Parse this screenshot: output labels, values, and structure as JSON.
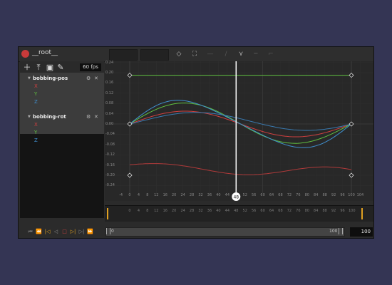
{
  "window": {
    "title": "__root__"
  },
  "toolbar": {
    "fps": "60 fps",
    "tools": [
      "add-icon",
      "upload-icon",
      "save-icon",
      "pencil-icon"
    ],
    "curve_tools": [
      "keyframe-diamond-icon",
      "fit-view-icon",
      "step-interp-icon",
      "linear-interp-icon",
      "bezier-interp-icon",
      "dashed-interp-icon",
      "hold-interp-icon"
    ]
  },
  "tracks": [
    {
      "name": "bobbing-pos",
      "axes": [
        {
          "label": "X",
          "color": "#d04040"
        },
        {
          "label": "Y",
          "color": "#60c040"
        },
        {
          "label": "Z",
          "color": "#4090d0"
        }
      ]
    },
    {
      "name": "bobbing-rot",
      "axes": [
        {
          "label": "X",
          "color": "#d04040"
        },
        {
          "label": "Y",
          "color": "#60c040"
        },
        {
          "label": "Z",
          "color": "#4090d0"
        }
      ]
    }
  ],
  "graph": {
    "y_ticks": [
      "0.24",
      "0.20",
      "0.16",
      "0.12",
      "0.08",
      "0.04",
      "0.00",
      "-0.04",
      "-0.08",
      "-0.12",
      "-0.16",
      "-0.20",
      "-0.24"
    ],
    "x_ticks": [
      "-4",
      "0",
      "4",
      "8",
      "12",
      "16",
      "20",
      "24",
      "28",
      "32",
      "36",
      "40",
      "44",
      "48",
      "52",
      "56",
      "60",
      "64",
      "68",
      "72",
      "76",
      "80",
      "84",
      "88",
      "92",
      "96",
      "100",
      "104"
    ],
    "playhead_label": "48"
  },
  "timeline": {
    "ticks": [
      "0",
      "4",
      "8",
      "12",
      "16",
      "20",
      "24",
      "28",
      "32",
      "36",
      "40",
      "44",
      "48",
      "52",
      "56",
      "60",
      "64",
      "68",
      "72",
      "76",
      "80",
      "84",
      "88",
      "92",
      "96",
      "100"
    ],
    "range_start": "0",
    "range_end": "100",
    "frame_value": "100"
  },
  "colors": {
    "x": "#d04040",
    "y": "#60c040",
    "z": "#4090d0",
    "playhead": "#ffffff",
    "accent": "#e0a020"
  }
}
